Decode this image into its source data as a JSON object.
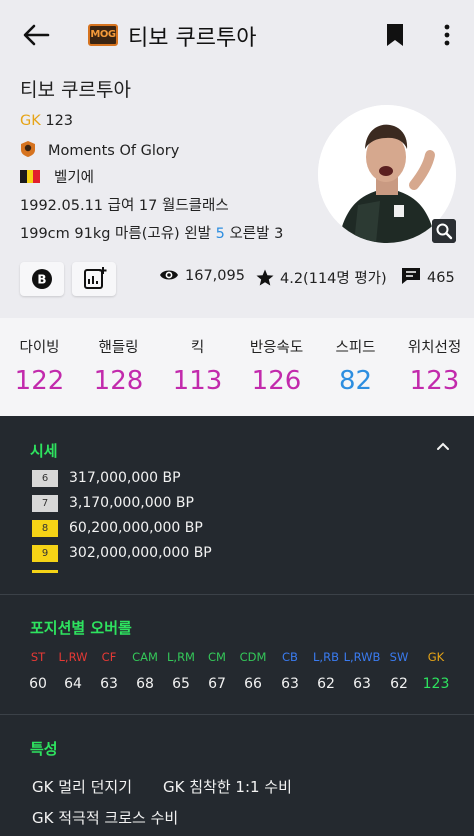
{
  "header": {
    "title": "티보 쿠르투아",
    "mog_logo": "MOG"
  },
  "profile": {
    "name": "티보 쿠르투아",
    "position": "GK",
    "overall": "123",
    "season": "Moments Of Glory",
    "nation": "벨기에",
    "info_line": "1992.05.11  급여 17  월드클래스",
    "body_prefix": "199cm 91kg  마름(고유)  왼발 ",
    "left_foot": "5",
    "body_suffix": " 오른발 3",
    "flag_colors": [
      "#1b1b1b",
      "#f5d316",
      "#e2202c"
    ]
  },
  "buttons": {
    "b_label": "B"
  },
  "stats": {
    "views": "167,095",
    "rating": "4.2(114명 평가)",
    "comments": "465"
  },
  "ratings": [
    {
      "label": "다이빙",
      "value": "122",
      "color": "#c22aac"
    },
    {
      "label": "핸들링",
      "value": "128",
      "color": "#c22aac"
    },
    {
      "label": "킥",
      "value": "113",
      "color": "#c22aac"
    },
    {
      "label": "반응속도",
      "value": "126",
      "color": "#c22aac"
    },
    {
      "label": "스피드",
      "value": "82",
      "color": "#2d8ee0"
    },
    {
      "label": "위치선정",
      "value": "123",
      "color": "#c22aac"
    }
  ],
  "market": {
    "title": "시세",
    "prices": [
      {
        "level": "6",
        "price": "317,000,000 BP",
        "badge_color": "#d8d8d8"
      },
      {
        "level": "7",
        "price": "3,170,000,000 BP",
        "badge_color": "#d8d8d8"
      },
      {
        "level": "8",
        "price": "60,200,000,000 BP",
        "badge_color": "#f5d316"
      },
      {
        "level": "9",
        "price": "302,000,000,000 BP",
        "badge_color": "#f5d316"
      }
    ]
  },
  "position_ovr": {
    "title": "포지션별 오버롤",
    "positions": [
      {
        "pos": "ST",
        "value": "60",
        "color": "#e53935"
      },
      {
        "pos": "L,RW",
        "value": "64",
        "color": "#e53935"
      },
      {
        "pos": "CF",
        "value": "63",
        "color": "#e53935"
      },
      {
        "pos": "CAM",
        "value": "68",
        "color": "#34c759"
      },
      {
        "pos": "L,RM",
        "value": "65",
        "color": "#34c759"
      },
      {
        "pos": "CM",
        "value": "67",
        "color": "#34c759"
      },
      {
        "pos": "CDM",
        "value": "66",
        "color": "#34c759"
      },
      {
        "pos": "CB",
        "value": "63",
        "color": "#3a7bf0"
      },
      {
        "pos": "L,RB",
        "value": "62",
        "color": "#3a7bf0"
      },
      {
        "pos": "L,RWB",
        "value": "63",
        "color": "#3a7bf0"
      },
      {
        "pos": "SW",
        "value": "62",
        "color": "#3a7bf0"
      },
      {
        "pos": "GK",
        "value": "123",
        "color": "#e6a417"
      }
    ]
  },
  "traits": {
    "title": "특성",
    "items": [
      "GK 멀리 던지기",
      "GK 침착한 1:1 수비",
      "GK 적극적 크로스 수비"
    ]
  }
}
